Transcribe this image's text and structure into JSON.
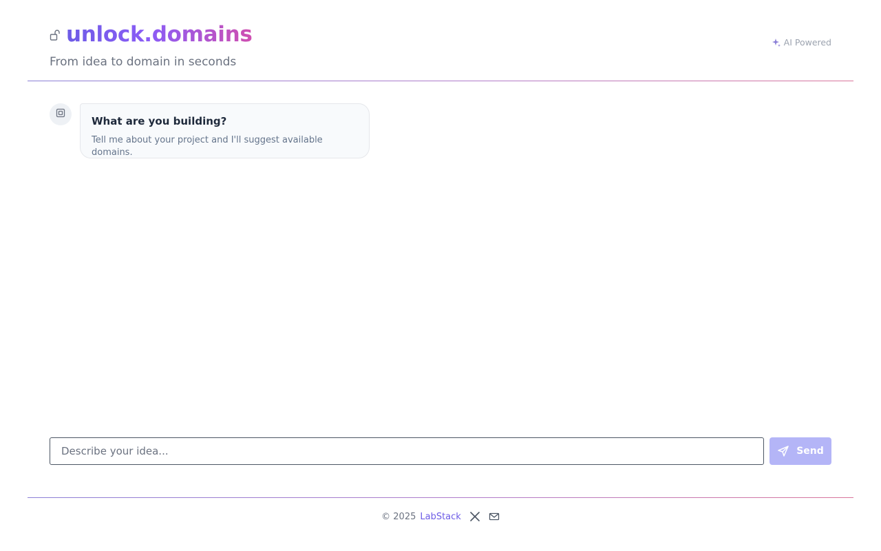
{
  "header": {
    "title": "unlock.domains",
    "tagline": "From idea to domain in seconds",
    "badge": "AI Powered",
    "icons": {
      "brand": "lock-open-icon",
      "badge": "sparkle-icon"
    }
  },
  "chat": {
    "messages": [
      {
        "avatar_icon": "chip-icon",
        "title": "What are you building?",
        "text": "Tell me about your project and I'll suggest available domains."
      }
    ]
  },
  "composer": {
    "placeholder": "Describe your idea...",
    "value": "",
    "send_label": "Send",
    "send_icon": "send-icon"
  },
  "footer": {
    "copyright": "© 2025",
    "link_text": "LabStack",
    "icons": [
      "x-logo-icon",
      "mail-icon"
    ]
  },
  "colors": {
    "accent": "#6d5ce6",
    "accent_pink": "#d04fb0",
    "send_button": "#b4b5f7",
    "muted_text": "#6b7280"
  }
}
